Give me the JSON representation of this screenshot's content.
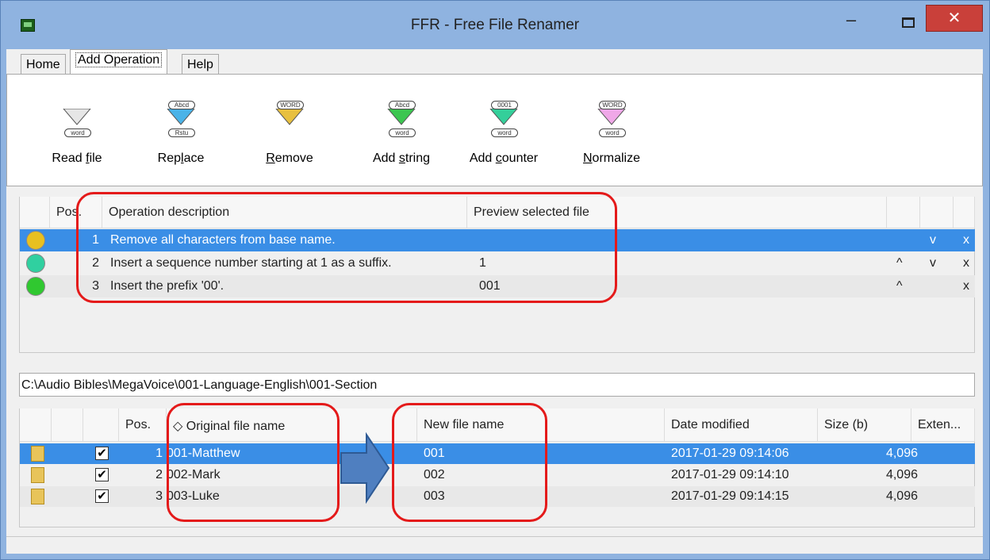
{
  "window": {
    "title": "FFR - Free File Renamer",
    "minimize": "‒",
    "close": "✕"
  },
  "tabs": [
    "Home",
    "Add Operation",
    "Help"
  ],
  "ribbon": [
    {
      "label_pre": "Read ",
      "label_u": "f",
      "label_post": "ile",
      "top": "",
      "bottom": "word",
      "color": "#e6e6e6"
    },
    {
      "label_pre": "Rep",
      "label_u": "l",
      "label_post": "ace",
      "top": "Abcd",
      "bottom": "Rstu",
      "color": "#4ab3e8"
    },
    {
      "label_pre": "",
      "label_u": "R",
      "label_post": "emove",
      "top": "WORD",
      "bottom": "",
      "color": "#e8c040"
    },
    {
      "label_pre": "Add ",
      "label_u": "s",
      "label_post": "tring",
      "top": "Abcd",
      "bottom": "word",
      "color": "#3cc650"
    },
    {
      "label_pre": "Add ",
      "label_u": "c",
      "label_post": "ounter",
      "top": "0001",
      "bottom": "word",
      "color": "#34cf9a"
    },
    {
      "label_pre": "",
      "label_u": "N",
      "label_post": "ormalize",
      "top": "WORD",
      "bottom": "word",
      "color": "#f0a8e8"
    }
  ],
  "ops_header": {
    "pos": "Pos.",
    "desc": "Operation description",
    "preview": "Preview selected file"
  },
  "operations": [
    {
      "pos": "1",
      "desc": "Remove all characters from base name.",
      "preview": "",
      "up": "",
      "down": "v",
      "del": "x",
      "color": "#e8c020"
    },
    {
      "pos": "2",
      "desc": "Insert a sequence number starting at 1 as a suffix.",
      "preview": "1",
      "up": "^",
      "down": "v",
      "del": "x",
      "color": "#30d0a0"
    },
    {
      "pos": "3",
      "desc": "Insert the prefix '00'.",
      "preview": "001",
      "up": "^",
      "down": "",
      "del": "x",
      "color": "#30c830"
    }
  ],
  "path": "C:\\Audio Bibles\\MegaVoice\\001-Language-English\\001-Section",
  "files_header": {
    "pos": "Pos.",
    "orig": "◇ Original file name",
    "newname": "New file name",
    "date": "Date modified",
    "size": "Size (b)",
    "ext": "Exten..."
  },
  "files": [
    {
      "pos": "1",
      "orig": "001-Matthew",
      "newname": "001",
      "date": "2017-01-29 09:14:06",
      "size": "4,096",
      "checked": "✔"
    },
    {
      "pos": "2",
      "orig": "002-Mark",
      "newname": "002",
      "date": "2017-01-29 09:14:10",
      "size": "4,096",
      "checked": "✔"
    },
    {
      "pos": "3",
      "orig": "003-Luke",
      "newname": "003",
      "date": "2017-01-29 09:14:15",
      "size": "4,096",
      "checked": "✔"
    }
  ]
}
